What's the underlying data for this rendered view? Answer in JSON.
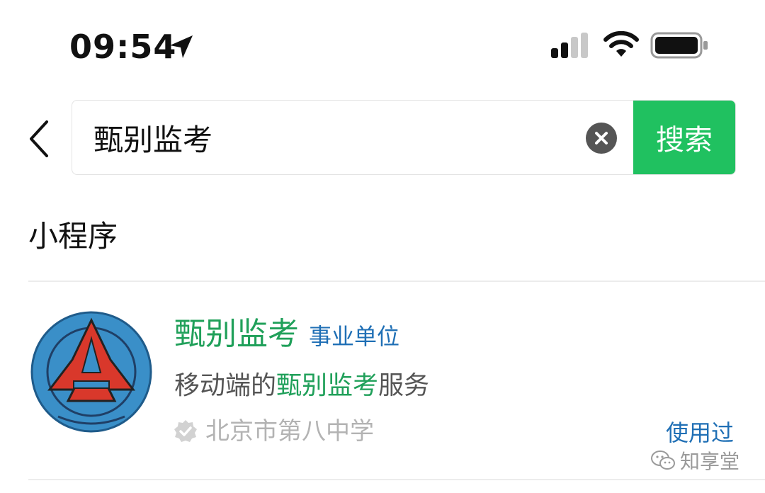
{
  "status_bar": {
    "time": "09:54",
    "icons": [
      "location-arrow-icon",
      "cellular-signal-icon",
      "wifi-icon",
      "battery-icon"
    ]
  },
  "search": {
    "back_icon": "chevron-left-icon",
    "query": "甄别监考",
    "clear_icon": "clear-circle-icon",
    "button_label": "搜索",
    "button_color": "#20c160"
  },
  "section": {
    "title": "小程序"
  },
  "results": [
    {
      "name": "甄别监考",
      "badge": "事业单位",
      "desc_prefix": "移动端的",
      "desc_highlight": "甄别监考",
      "desc_suffix": "服务",
      "owner": "北京市第八中学",
      "owner_icon": "verified-badge-icon",
      "used_label": "使用过",
      "name_color": "#20a05a",
      "badge_color": "#1f6fb5"
    }
  ],
  "watermark": {
    "text": "知享堂",
    "icon": "wechat-icon"
  }
}
